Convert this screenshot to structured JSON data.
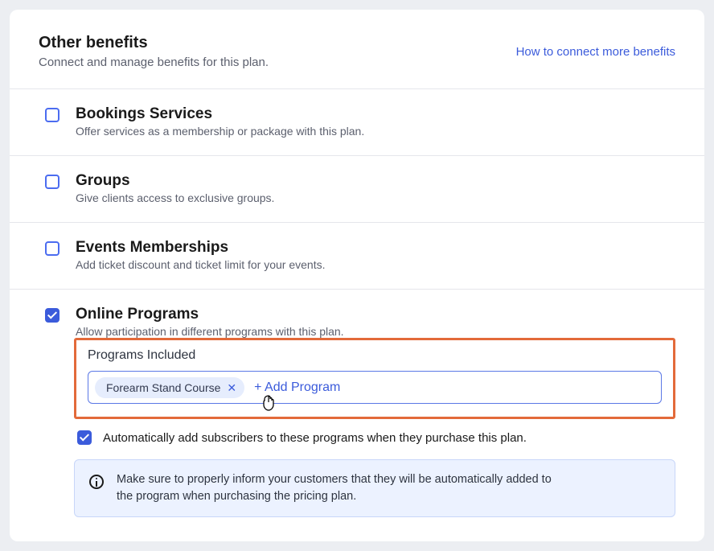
{
  "header": {
    "title": "Other benefits",
    "subtitle": "Connect and manage benefits for this plan.",
    "link": "How to connect more benefits"
  },
  "benefits": {
    "bookings": {
      "title": "Bookings Services",
      "desc": "Offer services as a membership or package with this plan."
    },
    "groups": {
      "title": "Groups",
      "desc": "Give clients access to exclusive groups."
    },
    "events": {
      "title": "Events Memberships",
      "desc": "Add ticket discount and ticket limit for your events."
    },
    "online_programs": {
      "title": "Online Programs",
      "desc": "Allow participation in different programs with this plan."
    }
  },
  "programs": {
    "label": "Programs Included",
    "chip": "Forearm Stand Course",
    "add": "+ Add Program",
    "auto_add": "Automatically add subscribers to these programs when they purchase this plan."
  },
  "info": {
    "text": "Make sure to properly inform your customers that they will be automatically added to the program when purchasing the pricing plan."
  }
}
